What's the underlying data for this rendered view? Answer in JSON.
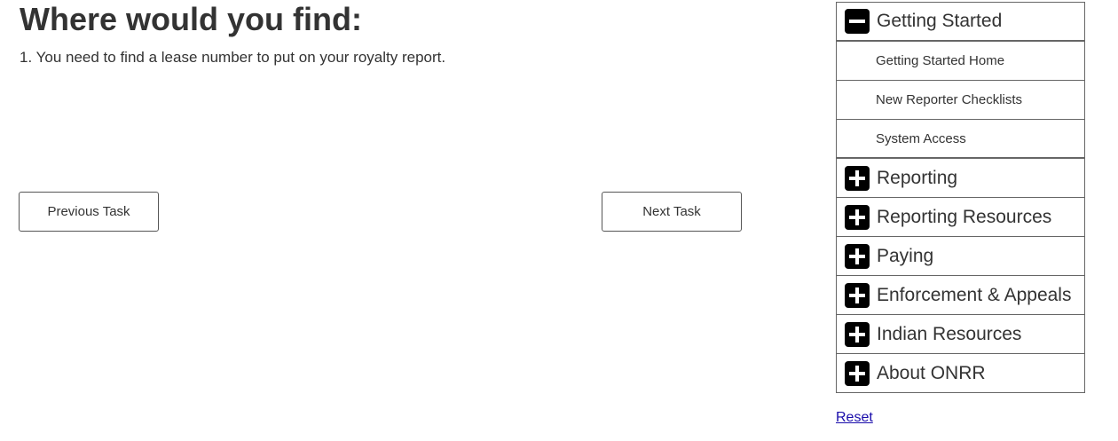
{
  "task": {
    "title": "Where would you find:",
    "question": "1. You need to find a lease number to put on your royalty report."
  },
  "buttons": {
    "previous": "Previous Task",
    "next": "Next Task"
  },
  "menu": {
    "expanded": {
      "label": "Getting Started",
      "icon": "minus-icon",
      "children": [
        "Getting Started Home",
        "New Reporter Checklists",
        "System Access"
      ]
    },
    "collapsed": [
      {
        "label": "Reporting",
        "icon": "plus-icon"
      },
      {
        "label": "Reporting Resources",
        "icon": "plus-icon"
      },
      {
        "label": "Paying",
        "icon": "plus-icon"
      },
      {
        "label": "Enforcement & Appeals",
        "icon": "plus-icon"
      },
      {
        "label": "Indian Resources",
        "icon": "plus-icon"
      },
      {
        "label": "About ONRR",
        "icon": "plus-icon"
      }
    ]
  },
  "reset_label": "Reset",
  "colors": {
    "text": "#333333",
    "icon_bg": "#000000",
    "border": "#666666",
    "link": "#1a0dab"
  }
}
